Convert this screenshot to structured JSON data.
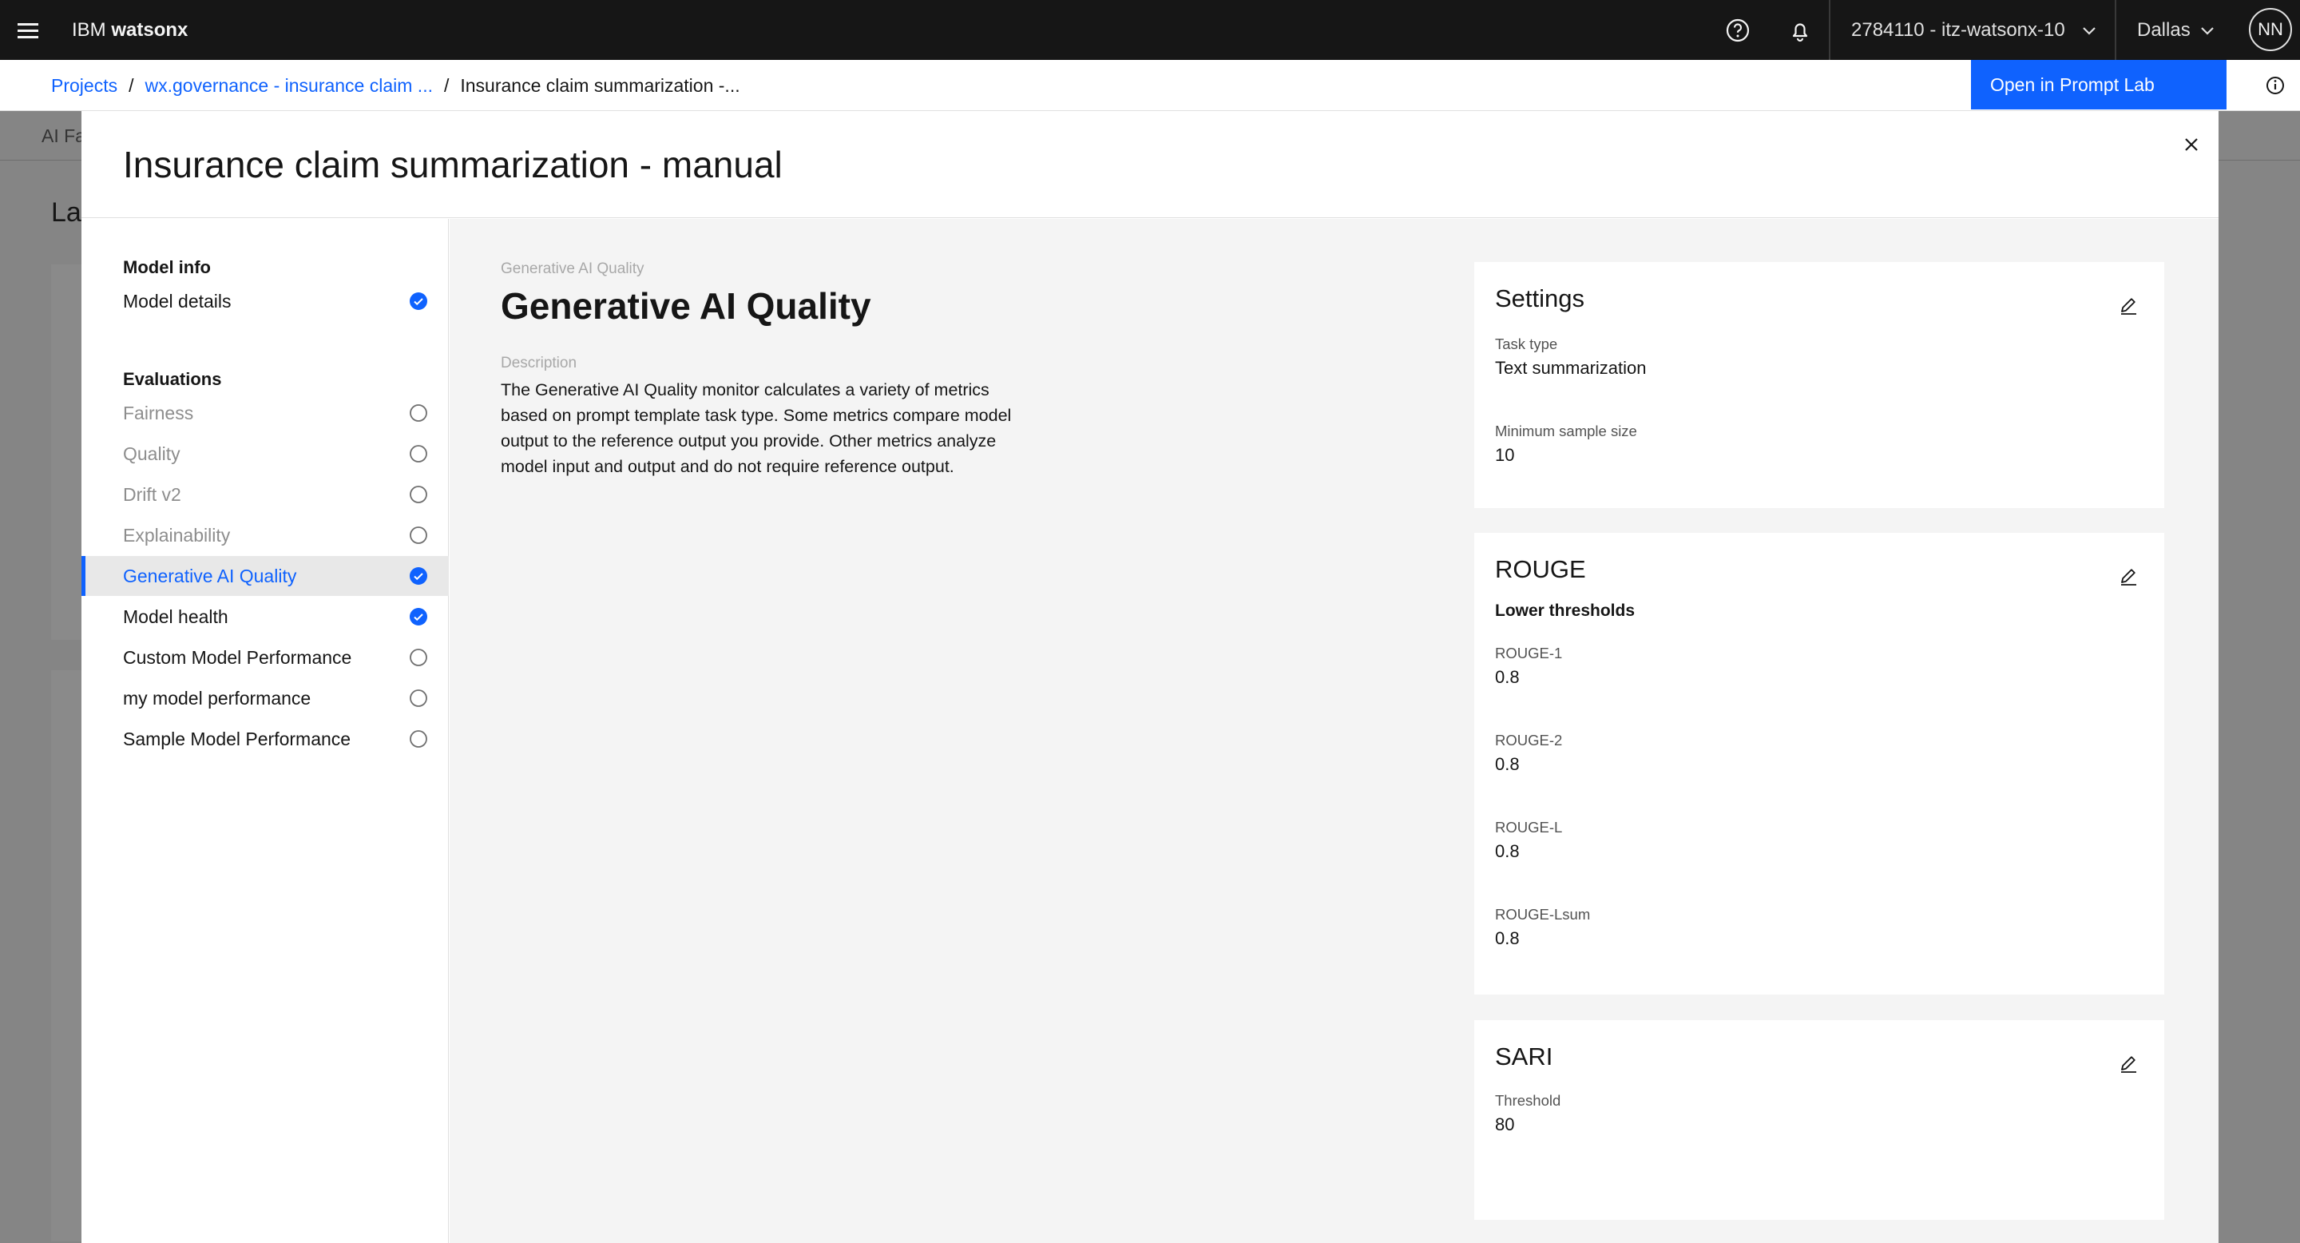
{
  "header": {
    "brand_prefix": "IBM",
    "brand_name": "watsonx",
    "account": "2784110 - itz-watsonx-10",
    "region": "Dallas",
    "avatar_initials": "NN"
  },
  "breadcrumb": {
    "items": [
      "Projects",
      "wx.governance - insurance claim ...",
      "Insurance claim summarization -..."
    ],
    "separator": "/"
  },
  "actions": {
    "open_prompt_lab": "Open in Prompt Lab"
  },
  "background": {
    "tab_label": "AI Fa",
    "heading": "Las"
  },
  "modal": {
    "title": "Insurance claim summarization - manual"
  },
  "sidebar": {
    "model_info_heading": "Model info",
    "model_info_items": [
      {
        "label": "Model details",
        "status": "complete"
      }
    ],
    "evaluations_heading": "Evaluations",
    "evaluation_items": [
      {
        "label": "Fairness",
        "status": "empty",
        "state": "disabled"
      },
      {
        "label": "Quality",
        "status": "empty",
        "state": "disabled"
      },
      {
        "label": "Drift v2",
        "status": "empty",
        "state": "disabled"
      },
      {
        "label": "Explainability",
        "status": "empty",
        "state": "disabled"
      },
      {
        "label": "Generative AI Quality",
        "status": "complete",
        "state": "active"
      },
      {
        "label": "Model health",
        "status": "complete",
        "state": "normal"
      },
      {
        "label": "Custom Model Performance",
        "status": "empty",
        "state": "normal"
      },
      {
        "label": "my model performance",
        "status": "empty",
        "state": "normal"
      },
      {
        "label": "Sample Model Performance",
        "status": "empty",
        "state": "normal"
      }
    ]
  },
  "main": {
    "eyebrow": "Generative AI Quality",
    "title": "Generative AI Quality",
    "description_label": "Description",
    "description": "The Generative AI Quality monitor calculates a variety of metrics based on prompt template task type. Some metrics compare model output to the reference output you provide. Other metrics analyze model input and output and do not require reference output."
  },
  "settings_card": {
    "title": "Settings",
    "task_type_label": "Task type",
    "task_type_value": "Text summarization",
    "min_sample_label": "Minimum sample size",
    "min_sample_value": "10"
  },
  "rouge_card": {
    "title": "ROUGE",
    "subtitle": "Lower thresholds",
    "metrics": [
      {
        "label": "ROUGE-1",
        "value": "0.8"
      },
      {
        "label": "ROUGE-2",
        "value": "0.8"
      },
      {
        "label": "ROUGE-L",
        "value": "0.8"
      },
      {
        "label": "ROUGE-Lsum",
        "value": "0.8"
      }
    ]
  },
  "sari_card": {
    "title": "SARI",
    "threshold_label": "Threshold",
    "threshold_value": "80"
  },
  "colors": {
    "accent": "#0f62fe",
    "header_bg": "#161616",
    "panel_bg": "#f4f4f4"
  },
  "icons": {
    "menu": "hamburger-icon",
    "help": "help-icon",
    "notification": "bell-icon",
    "chevron": "chevron-down-icon",
    "close": "close-icon",
    "edit": "pencil-icon",
    "info": "info-icon",
    "complete": "checkmark-filled-icon",
    "empty": "circle-outline-icon"
  }
}
